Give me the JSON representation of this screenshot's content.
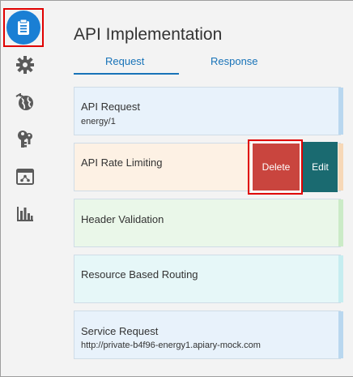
{
  "header": {
    "title": "API Implementation"
  },
  "tabs": [
    {
      "label": "Request"
    },
    {
      "label": "Response"
    }
  ],
  "cards": [
    {
      "title": "API Request",
      "subtitle": "energy/1",
      "bg": "#e8f2fb",
      "edge": "#b9d7ef"
    },
    {
      "title": "API Rate Limiting",
      "subtitle": "",
      "bg": "#fdf1e4",
      "edge": "#f7d8b7"
    },
    {
      "title": "Header Validation",
      "subtitle": "",
      "bg": "#eaf7e9",
      "edge": "#cbebc7"
    },
    {
      "title": "Resource Based Routing",
      "subtitle": "",
      "bg": "#e6f7f8",
      "edge": "#c6edf0"
    },
    {
      "title": "Service Request",
      "subtitle": "http://private-b4f96-energy1.apiary-mock.com",
      "bg": "#e8f2fb",
      "edge": "#b9d7ef"
    }
  ],
  "actions": {
    "delete_label": "Delete",
    "edit_label": "Edit"
  },
  "sidebar": {
    "items": [
      {
        "icon": "clipboard-icon"
      },
      {
        "icon": "gear-icon"
      },
      {
        "icon": "globe-icon"
      },
      {
        "icon": "keys-icon"
      },
      {
        "icon": "hierarchy-icon"
      },
      {
        "icon": "bar-chart-icon"
      }
    ]
  },
  "colors": {
    "accent": "#1a7fd4",
    "delete": "#c9453e",
    "edit": "#1a6a70",
    "highlight": "#e00000"
  }
}
